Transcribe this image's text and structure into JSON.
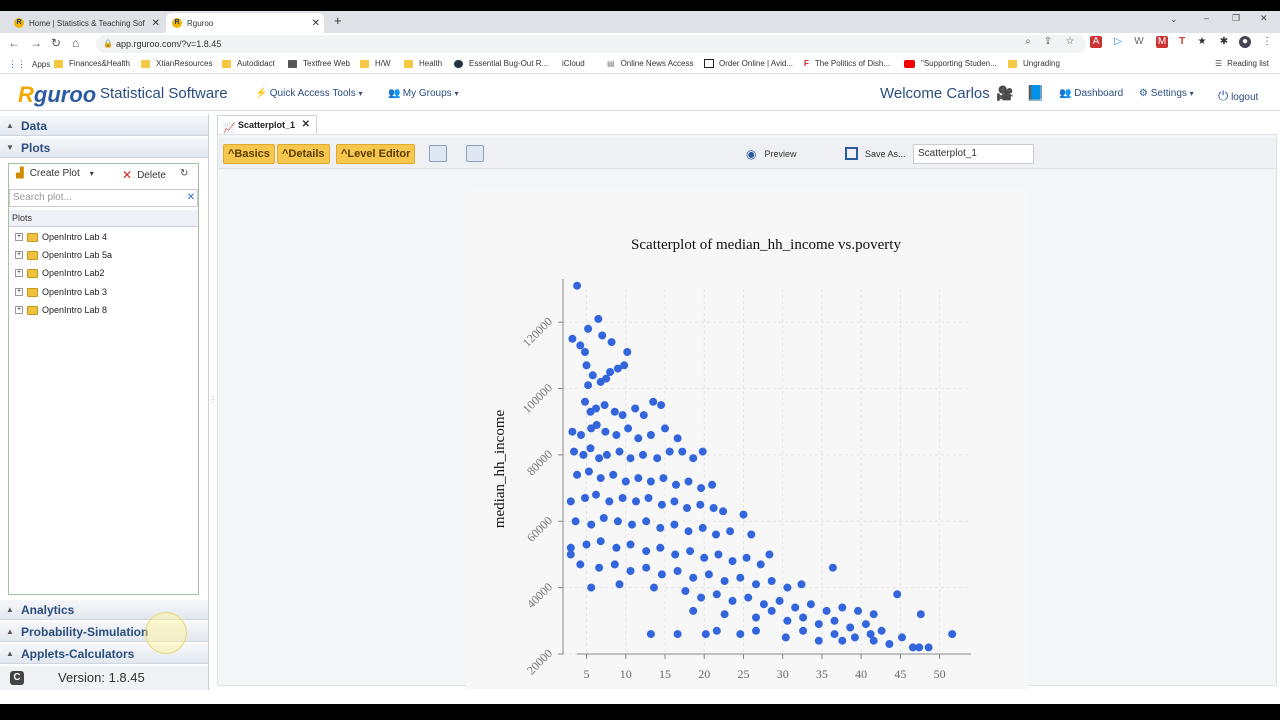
{
  "browser": {
    "tabs": [
      {
        "title": "Home | Statistics & Teaching Sof",
        "active": false
      },
      {
        "title": "Rguroo",
        "active": true
      }
    ],
    "url": "app.rguroo.com/?v=1.8.45",
    "bookmarks": [
      "Apps",
      "Finances&Health",
      "XtianResources",
      "Autodidact",
      "Textfree Web",
      "H/W",
      "Health",
      "Essential Bug-Out R...",
      "iCloud",
      "Online News Access",
      "Order Online | Avid...",
      "The Politics of Dish...",
      "\"Supporting Studen...",
      "Ungrading"
    ],
    "reading_list": "Reading list"
  },
  "app": {
    "logo": "guroo",
    "logo_r": "R",
    "title": "Statistical Software",
    "quick_access": "Quick Access Tools",
    "my_groups": "My Groups",
    "welcome": "Welcome Carlos",
    "dashboard": "Dashboard",
    "settings": "Settings",
    "logout": "logout"
  },
  "left_panel": {
    "data_label": "Data",
    "plots_label": "Plots",
    "create_plot": "Create Plot",
    "delete": "Delete",
    "search_placeholder": "Search plot...",
    "plots_header": "Plots",
    "tree_items": [
      "OpenIntro Lab 4",
      "OpenIntro Lab 5a",
      "OpenIntro Lab2",
      "OpenIntro Lab 3",
      "OpenIntro Lab 8"
    ],
    "analytics": "Analytics",
    "probability": "Probability-Simulation",
    "applets": "Applets-Calculators",
    "version": "Version: 1.8.45"
  },
  "main": {
    "doc_tab": "Scatterplot_1",
    "basics": "^Basics",
    "details": "^Details",
    "level_editor": "^Level Editor",
    "preview": "Preview",
    "save_as": "Save As...",
    "plot_name": "Scatterplot_1"
  },
  "chart_data": {
    "type": "scatter",
    "title": "Scatterplot of median_hh_income vs.poverty",
    "xlabel": "",
    "ylabel": "median_hh_income",
    "xlim": [
      2,
      54
    ],
    "ylim": [
      20000,
      130000
    ],
    "xticks": [
      5,
      10,
      15,
      20,
      25,
      30,
      35,
      40,
      45,
      50
    ],
    "yticks": [
      20000,
      40000,
      60000,
      80000,
      100000,
      120000
    ],
    "grid": true,
    "color": "#3366dd",
    "points": [
      [
        3.8,
        131000
      ],
      [
        3.2,
        115000
      ],
      [
        4.2,
        113000
      ],
      [
        5.2,
        118000
      ],
      [
        4.8,
        111000
      ],
      [
        6.5,
        121000
      ],
      [
        7.0,
        116000
      ],
      [
        8.2,
        114000
      ],
      [
        10.2,
        111000
      ],
      [
        5.0,
        107000
      ],
      [
        5.8,
        104000
      ],
      [
        5.2,
        101000
      ],
      [
        6.8,
        102000
      ],
      [
        8.0,
        105000
      ],
      [
        9.0,
        106000
      ],
      [
        9.8,
        107000
      ],
      [
        7.5,
        103000
      ],
      [
        4.8,
        96000
      ],
      [
        5.5,
        93000
      ],
      [
        6.2,
        94000
      ],
      [
        7.3,
        95000
      ],
      [
        8.6,
        93000
      ],
      [
        9.6,
        92000
      ],
      [
        11.2,
        94000
      ],
      [
        12.3,
        92000
      ],
      [
        13.5,
        96000
      ],
      [
        14.5,
        95000
      ],
      [
        3.2,
        87000
      ],
      [
        4.3,
        86000
      ],
      [
        5.6,
        88000
      ],
      [
        6.3,
        89000
      ],
      [
        7.4,
        87000
      ],
      [
        8.8,
        86000
      ],
      [
        10.3,
        88000
      ],
      [
        11.6,
        85000
      ],
      [
        13.2,
        86000
      ],
      [
        15.0,
        88000
      ],
      [
        16.6,
        85000
      ],
      [
        3.4,
        81000
      ],
      [
        4.6,
        80000
      ],
      [
        5.5,
        82000
      ],
      [
        6.6,
        79000
      ],
      [
        7.6,
        80000
      ],
      [
        9.2,
        81000
      ],
      [
        10.6,
        79000
      ],
      [
        12.2,
        80000
      ],
      [
        14.0,
        79000
      ],
      [
        15.6,
        81000
      ],
      [
        17.2,
        81000
      ],
      [
        18.6,
        79000
      ],
      [
        19.8,
        81000
      ],
      [
        3.8,
        74000
      ],
      [
        5.3,
        75000
      ],
      [
        6.8,
        73000
      ],
      [
        8.4,
        74000
      ],
      [
        10.0,
        72000
      ],
      [
        11.6,
        73000
      ],
      [
        13.2,
        72000
      ],
      [
        14.8,
        73000
      ],
      [
        16.4,
        71000
      ],
      [
        18.0,
        72000
      ],
      [
        19.6,
        70000
      ],
      [
        21.0,
        71000
      ],
      [
        3.0,
        66000
      ],
      [
        4.8,
        67000
      ],
      [
        6.2,
        68000
      ],
      [
        7.9,
        66000
      ],
      [
        9.6,
        67000
      ],
      [
        11.3,
        66000
      ],
      [
        12.9,
        67000
      ],
      [
        14.6,
        65000
      ],
      [
        16.2,
        66000
      ],
      [
        17.8,
        64000
      ],
      [
        19.5,
        65000
      ],
      [
        21.2,
        64000
      ],
      [
        22.4,
        63000
      ],
      [
        3.6,
        60000
      ],
      [
        5.6,
        59000
      ],
      [
        7.2,
        61000
      ],
      [
        9.0,
        60000
      ],
      [
        10.8,
        59000
      ],
      [
        12.6,
        60000
      ],
      [
        14.4,
        58000
      ],
      [
        16.2,
        59000
      ],
      [
        18.0,
        57000
      ],
      [
        19.8,
        58000
      ],
      [
        21.5,
        56000
      ],
      [
        23.3,
        57000
      ],
      [
        25.0,
        62000
      ],
      [
        26.0,
        56000
      ],
      [
        3.0,
        52000
      ],
      [
        5.0,
        53000
      ],
      [
        6.8,
        54000
      ],
      [
        8.8,
        52000
      ],
      [
        10.6,
        53000
      ],
      [
        12.6,
        51000
      ],
      [
        14.4,
        52000
      ],
      [
        16.3,
        50000
      ],
      [
        18.2,
        51000
      ],
      [
        20.0,
        49000
      ],
      [
        21.8,
        50000
      ],
      [
        23.6,
        48000
      ],
      [
        25.4,
        49000
      ],
      [
        27.2,
        47000
      ],
      [
        28.3,
        50000
      ],
      [
        3.0,
        50000
      ],
      [
        4.2,
        47000
      ],
      [
        6.6,
        46000
      ],
      [
        8.6,
        47000
      ],
      [
        10.6,
        45000
      ],
      [
        12.6,
        46000
      ],
      [
        14.6,
        44000
      ],
      [
        16.6,
        45000
      ],
      [
        18.6,
        43000
      ],
      [
        20.6,
        44000
      ],
      [
        22.6,
        42000
      ],
      [
        24.6,
        43000
      ],
      [
        26.6,
        41000
      ],
      [
        28.6,
        42000
      ],
      [
        30.6,
        40000
      ],
      [
        32.4,
        41000
      ],
      [
        36.4,
        46000
      ],
      [
        5.6,
        40000
      ],
      [
        9.2,
        41000
      ],
      [
        13.6,
        40000
      ],
      [
        17.6,
        39000
      ],
      [
        19.6,
        37000
      ],
      [
        21.6,
        38000
      ],
      [
        23.6,
        36000
      ],
      [
        25.6,
        37000
      ],
      [
        27.6,
        35000
      ],
      [
        29.6,
        36000
      ],
      [
        31.6,
        34000
      ],
      [
        33.6,
        35000
      ],
      [
        35.6,
        33000
      ],
      [
        37.6,
        34000
      ],
      [
        39.6,
        33000
      ],
      [
        41.6,
        32000
      ],
      [
        44.6,
        38000
      ],
      [
        18.6,
        33000
      ],
      [
        22.6,
        32000
      ],
      [
        26.6,
        31000
      ],
      [
        28.6,
        33000
      ],
      [
        30.6,
        30000
      ],
      [
        32.6,
        31000
      ],
      [
        34.6,
        29000
      ],
      [
        36.6,
        30000
      ],
      [
        38.6,
        28000
      ],
      [
        40.6,
        29000
      ],
      [
        42.6,
        27000
      ],
      [
        47.6,
        32000
      ],
      [
        13.2,
        26000
      ],
      [
        16.6,
        26000
      ],
      [
        20.2,
        26000
      ],
      [
        21.6,
        27000
      ],
      [
        24.6,
        26000
      ],
      [
        26.6,
        27000
      ],
      [
        30.4,
        25000
      ],
      [
        32.6,
        27000
      ],
      [
        34.6,
        24000
      ],
      [
        36.6,
        26000
      ],
      [
        37.6,
        24000
      ],
      [
        39.2,
        25000
      ],
      [
        41.2,
        26000
      ],
      [
        43.6,
        23000
      ],
      [
        45.2,
        25000
      ],
      [
        46.6,
        22000
      ],
      [
        47.4,
        22000
      ],
      [
        48.6,
        22000
      ],
      [
        51.6,
        26000
      ],
      [
        41.6,
        24000
      ]
    ]
  }
}
